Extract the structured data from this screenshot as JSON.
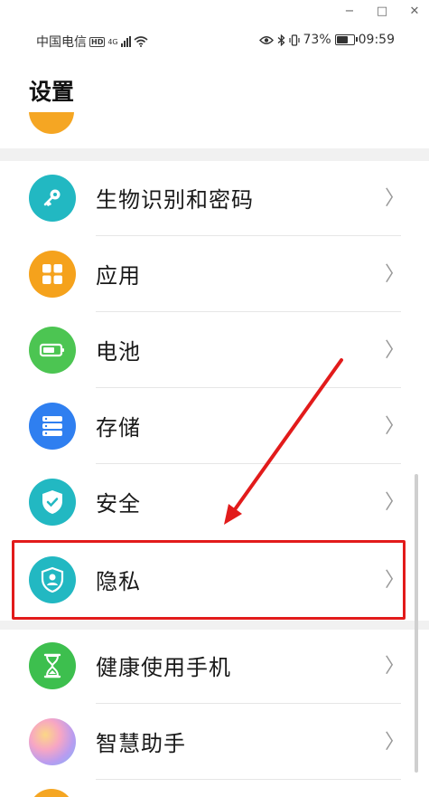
{
  "status_bar": {
    "carrier": "中国电信",
    "hd_badge": "HD",
    "net_type": "4G",
    "battery": "73%",
    "battery_level": 0.73,
    "time": "09:59"
  },
  "window_controls": {
    "minimize": "−",
    "maximize": "□",
    "close": "✕"
  },
  "page": {
    "title": "设置"
  },
  "items": [
    {
      "label": "生物识别和密码",
      "icon": "key-icon",
      "color": "#22b8c2"
    },
    {
      "label": "应用",
      "icon": "apps-icon",
      "color": "#f5a21c"
    },
    {
      "label": "电池",
      "icon": "battery-icon",
      "color": "#4cc552"
    },
    {
      "label": "存储",
      "icon": "storage-icon",
      "color": "#2f7ff0"
    },
    {
      "label": "安全",
      "icon": "shield-check-icon",
      "color": "#22b8c2"
    },
    {
      "label": "隐私",
      "icon": "privacy-icon",
      "color": "#22b8c2"
    },
    {
      "label": "健康使用手机",
      "icon": "hourglass-icon",
      "color": "#3dbf4e"
    },
    {
      "label": "智慧助手",
      "icon": "smart-assistant-icon",
      "color": "#b99cf0"
    }
  ],
  "highlight_color": "#e21b1b"
}
